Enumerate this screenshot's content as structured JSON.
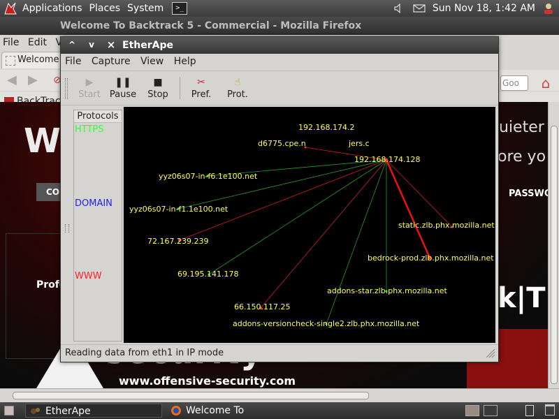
{
  "top_panel": {
    "menus": [
      "Applications",
      "Places",
      "System"
    ],
    "terminal_glyph": ">_",
    "clock": "Sun Nov 18,  1:42 AM",
    "icons": [
      "backtrack-dragon-icon",
      "terminal-icon",
      "volume-icon",
      "mail-icon",
      "user-icon"
    ]
  },
  "firefox": {
    "title": "Welcome To Backtrack 5 - Commercial - Mozilla Firefox",
    "menus": [
      "File",
      "Edit",
      "V"
    ],
    "tab_label": "Welcome",
    "search_placeholder": "Goo",
    "bookmark": "BackTrack",
    "page": {
      "big_letter": "We",
      "quieter": "uieter y",
      "more": "ore yo",
      "button_co": "CO",
      "password": "PASSWO",
      "professional": "Profe",
      "kt": "k|T",
      "security": "security",
      "website": "www.offensive-security.com"
    }
  },
  "etherape": {
    "title": "EtherApe",
    "title_buttons": [
      "^",
      "v",
      "×"
    ],
    "menus": [
      "File",
      "Capture",
      "View",
      "Help"
    ],
    "toolbar": [
      {
        "label": "Start",
        "enabled": false,
        "icon": "start-icon"
      },
      {
        "label": "Pause",
        "enabled": true,
        "icon": "pause-icon"
      },
      {
        "label": "Stop",
        "enabled": true,
        "icon": "stop-icon"
      },
      {
        "label": "Pref.",
        "enabled": true,
        "icon": "preferences-icon"
      },
      {
        "label": "Prot.",
        "enabled": true,
        "icon": "protocols-icon"
      }
    ],
    "protocols": {
      "header": "Protocols",
      "items": [
        {
          "name": "HTTPS",
          "color": "#33ff33"
        },
        {
          "name": "DOMAIN",
          "color": "#2222ee"
        },
        {
          "name": "WWW",
          "color": "#ff2222"
        }
      ]
    },
    "graph": {
      "center": "192.168.174.128",
      "nodes": [
        {
          "label": "192.168.174.2",
          "link": "none"
        },
        {
          "label": "d6775.cpe.n",
          "link": "red"
        },
        {
          "label": "jers.c",
          "link": "none"
        },
        {
          "label": "yyz06s07-in-f6.1e100.net",
          "link": "green"
        },
        {
          "label": "yyz06s07-in-f1.1e100.net",
          "link": "green"
        },
        {
          "label": "72.167.239.239",
          "link": "red"
        },
        {
          "label": "69.195.141.178",
          "link": "green"
        },
        {
          "label": "66.150.117.25",
          "link": "red"
        },
        {
          "label": "addons-versioncheck-single2.zlb.phx.mozilla.net",
          "link": "green"
        },
        {
          "label": "addons-star.zlb.phx.mozilla.net",
          "link": "green"
        },
        {
          "label": "bedrock-prod.zlb.phx.mozilla.net",
          "link": "red-thick"
        },
        {
          "label": "static.zlb.phx.mozilla.net",
          "link": "red"
        }
      ]
    },
    "status": "Reading data from eth1 in IP mode"
  },
  "bottom_panel": {
    "tasks": [
      {
        "label": "EtherApe",
        "active": true,
        "icon": "etherape-icon"
      },
      {
        "label": "Welcome To Backtrack...",
        "active": false,
        "icon": "firefox-icon"
      }
    ]
  }
}
